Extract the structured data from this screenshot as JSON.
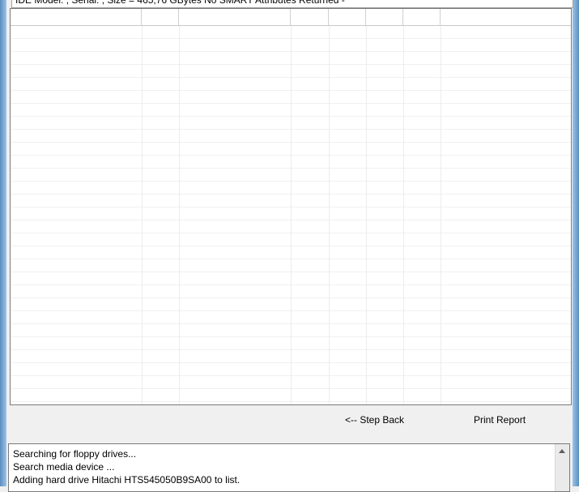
{
  "status_line": "IDE Model: , Serial: , Size = 465,76 GBytes  No SMART Attributes Returned -",
  "grid": {
    "columns": [
      "",
      "",
      "",
      "",
      "",
      "",
      "",
      ""
    ],
    "rows": []
  },
  "buttons": {
    "step_back": "<-- Step Back",
    "print_report": "Print Report"
  },
  "log": {
    "lines": [
      "Searching for floppy drives...",
      "Search media device ...",
      "Adding hard drive Hitachi HTS545050B9SA00 to list."
    ]
  },
  "icons": {
    "scroll_up": "scroll-up-arrow-icon"
  }
}
